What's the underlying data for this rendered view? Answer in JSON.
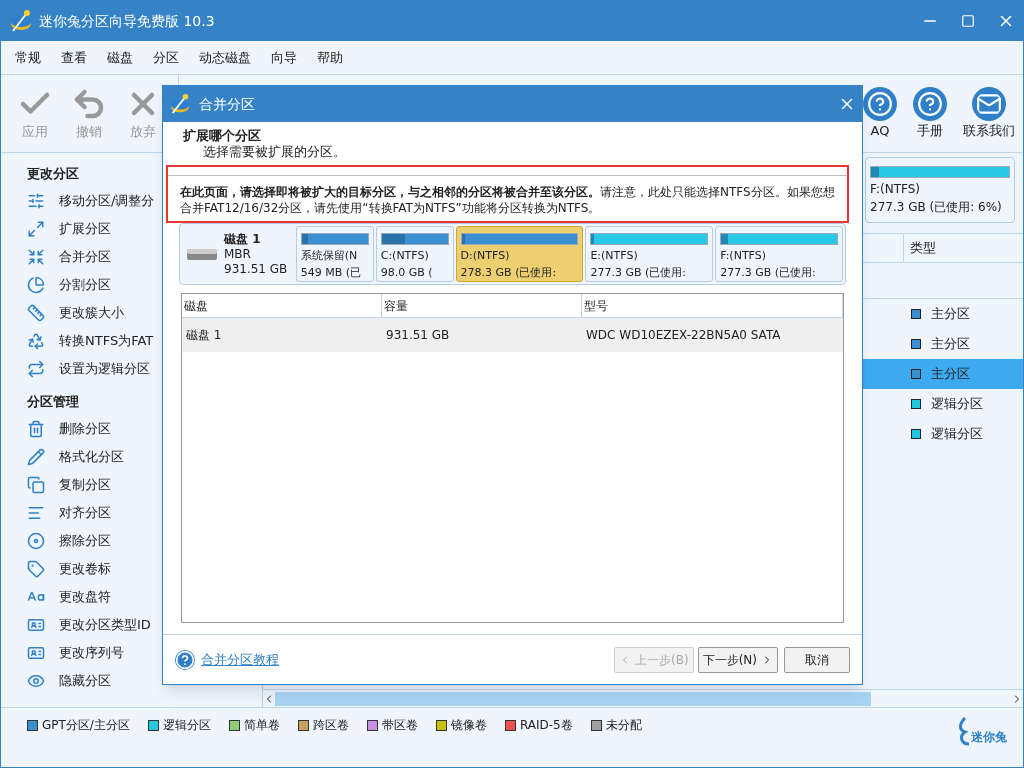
{
  "window": {
    "title": "迷你兔分区向导免费版 10.3"
  },
  "menu": [
    "常规",
    "查看",
    "磁盘",
    "分区",
    "动态磁盘",
    "向导",
    "帮助"
  ],
  "toolbar_left": [
    {
      "label": "应用",
      "kind": "check"
    },
    {
      "label": "撤销",
      "kind": "undo"
    },
    {
      "label": "放弃",
      "kind": "discard"
    }
  ],
  "toolbar_right": [
    {
      "label": "AQ",
      "kind": "faq"
    },
    {
      "label": "手册",
      "kind": "help"
    },
    {
      "label": "联系我们",
      "kind": "mail"
    }
  ],
  "sidebar": [
    {
      "title": "更改分区",
      "items": [
        {
          "label": "移动分区/调整分",
          "kind": "move"
        },
        {
          "label": "扩展分区",
          "kind": "extend"
        },
        {
          "label": "合并分区",
          "kind": "merge"
        },
        {
          "label": "分割分区",
          "kind": "split"
        },
        {
          "label": "更改簇大小",
          "kind": "cluster"
        },
        {
          "label": "转换NTFS为FAT",
          "kind": "convert"
        },
        {
          "label": "设置为逻辑分区",
          "kind": "swap"
        }
      ]
    },
    {
      "title": "分区管理",
      "items": [
        {
          "label": "删除分区",
          "kind": "delete"
        },
        {
          "label": "格式化分区",
          "kind": "format"
        },
        {
          "label": "复制分区",
          "kind": "copy"
        },
        {
          "label": "对齐分区",
          "kind": "align"
        },
        {
          "label": "擦除分区",
          "kind": "wipe"
        },
        {
          "label": "更改卷标",
          "kind": "label"
        },
        {
          "label": "更改盘符",
          "kind": "letter"
        },
        {
          "label": "更改分区类型ID",
          "kind": "id"
        },
        {
          "label": "更改序列号",
          "kind": "id"
        },
        {
          "label": "隐藏分区",
          "kind": "hide"
        }
      ]
    }
  ],
  "disk_map_partial": {
    "name": "F:(NTFS)",
    "size": "277.3 GB (已使用: 6%)",
    "color": "#28c8e6",
    "level": 0.06
  },
  "partition_table": {
    "column": "类型",
    "rows": [
      {
        "type": "主分区",
        "color": "#3a8fd0",
        "selected": false
      },
      {
        "type": "主分区",
        "color": "#3a8fd0",
        "selected": false
      },
      {
        "type": "主分区",
        "color": "#3a8fd0",
        "selected": true
      },
      {
        "type": "逻辑分区",
        "color": "#22c8e0",
        "selected": false
      },
      {
        "type": "逻辑分区",
        "color": "#22c8e0",
        "selected": false
      }
    ]
  },
  "legend": [
    {
      "label": "GPT分区/主分区",
      "color": "#3a8fd0"
    },
    {
      "label": "逻辑分区",
      "color": "#22c8e0"
    },
    {
      "label": "简单卷",
      "color": "#90cc78"
    },
    {
      "label": "跨区卷",
      "color": "#c8a060"
    },
    {
      "label": "带区卷",
      "color": "#c890e0"
    },
    {
      "label": "镜像卷",
      "color": "#c8c000"
    },
    {
      "label": "RAID-5卷",
      "color": "#f05050"
    },
    {
      "label": "未分配",
      "color": "#a0a0a0"
    }
  ],
  "logo": {
    "text": "迷你兔"
  },
  "dialog": {
    "title": "合并分区",
    "heading": "扩展哪个分区",
    "subheading": "选择需要被扩展的分区。",
    "note": "**在此页面，请选择即将被扩大的目标分区，与之相邻的分区将被合并至该分区。**请注意，此处只能选择NTFS分区。如果您想合并FAT12/16/32分区，请先使用“转换FAT为NTFS”功能将分区转换为NTFS。",
    "disk": {
      "name": "磁盘 1",
      "scheme": "MBR",
      "size": "931.51 GB"
    },
    "partitions": [
      {
        "name": "系统保留(N",
        "size": "549 MB (已",
        "color": "#3a8fd0",
        "level": 0.1,
        "selected": false
      },
      {
        "name": "C:(NTFS)",
        "size": "98.0 GB (",
        "color": "#3a8fd0",
        "level": 0.35,
        "selected": false
      },
      {
        "name": "D:(NTFS)",
        "size": "278.3 GB (已使用:",
        "color": "#3a8fd0",
        "level": 0.03,
        "selected": true
      },
      {
        "name": "E:(NTFS)",
        "size": "277.3 GB (已使用:",
        "color": "#28c8e6",
        "level": 0.02,
        "selected": false
      },
      {
        "name": "F:(NTFS)",
        "size": "277.3 GB (已使用:",
        "color": "#28c8e6",
        "level": 0.06,
        "selected": false
      }
    ],
    "table": {
      "columns": [
        "磁盘",
        "容量",
        "型号"
      ],
      "rows": [
        {
          "cells": [
            "磁盘 1",
            "931.51 GB",
            "WDC WD10EZEX-22BN5A0 SATA"
          ],
          "selected": true
        }
      ]
    },
    "help_link": "合并分区教程",
    "buttons": [
      {
        "label": "上一步(B)",
        "kind": "back",
        "disabled": true
      },
      {
        "label": "下一步(N)",
        "kind": "next",
        "disabled": false
      },
      {
        "label": "取消",
        "kind": "plain",
        "disabled": false
      }
    ]
  }
}
